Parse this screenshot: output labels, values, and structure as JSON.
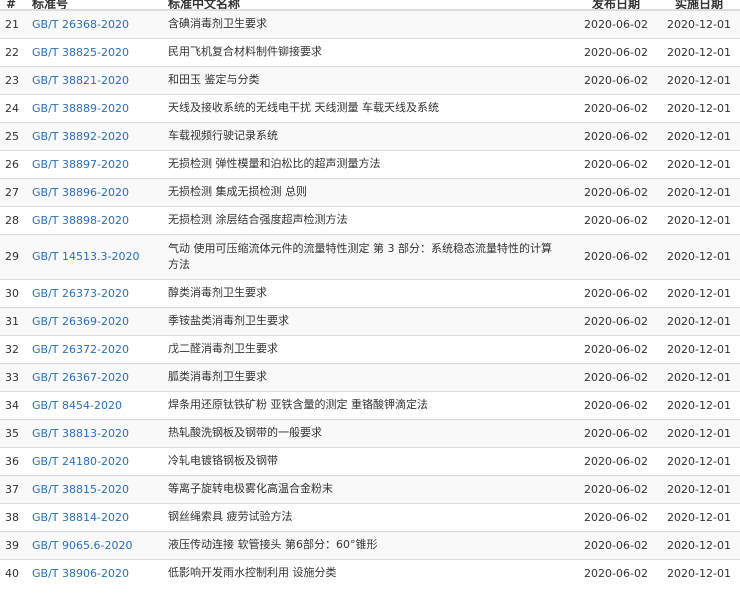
{
  "headers": {
    "num": "#",
    "code": "标准号",
    "title": "标准中文名称",
    "publish": "发布日期",
    "effective": "实施日期"
  },
  "rows": [
    {
      "num": "21",
      "code": "GB/T 26368-2020",
      "title": "含碘消毒剂卫生要求",
      "publish": "2020-06-02",
      "effective": "2020-12-01"
    },
    {
      "num": "22",
      "code": "GB/T 38825-2020",
      "title": "民用飞机复合材料制件铆接要求",
      "publish": "2020-06-02",
      "effective": "2020-12-01"
    },
    {
      "num": "23",
      "code": "GB/T 38821-2020",
      "title": "和田玉 鉴定与分类",
      "publish": "2020-06-02",
      "effective": "2020-12-01"
    },
    {
      "num": "24",
      "code": "GB/T 38889-2020",
      "title": "天线及接收系统的无线电干扰 天线测量 车载天线及系统",
      "publish": "2020-06-02",
      "effective": "2020-12-01"
    },
    {
      "num": "25",
      "code": "GB/T 38892-2020",
      "title": "车载视频行驶记录系统",
      "publish": "2020-06-02",
      "effective": "2020-12-01"
    },
    {
      "num": "26",
      "code": "GB/T 38897-2020",
      "title": "无损检测 弹性模量和泊松比的超声测量方法",
      "publish": "2020-06-02",
      "effective": "2020-12-01"
    },
    {
      "num": "27",
      "code": "GB/T 38896-2020",
      "title": "无损检测 集成无损检测 总则",
      "publish": "2020-06-02",
      "effective": "2020-12-01"
    },
    {
      "num": "28",
      "code": "GB/T 38898-2020",
      "title": "无损检测 涂层结合强度超声检测方法",
      "publish": "2020-06-02",
      "effective": "2020-12-01"
    },
    {
      "num": "29",
      "code": "GB/T 14513.3-2020",
      "title": "气动 使用可压缩流体元件的流量特性测定 第 3 部分：系统稳态流量特性的计算方法",
      "title_line1": "气动 使用可压缩流体元件的流量特性测定 第 3 部分：系统稳态流量特性的计算",
      "title_line2": "方法",
      "publish": "2020-06-02",
      "effective": "2020-12-01"
    },
    {
      "num": "30",
      "code": "GB/T 26373-2020",
      "title": "醇类消毒剂卫生要求",
      "publish": "2020-06-02",
      "effective": "2020-12-01"
    },
    {
      "num": "31",
      "code": "GB/T 26369-2020",
      "title": "季铵盐类消毒剂卫生要求",
      "publish": "2020-06-02",
      "effective": "2020-12-01"
    },
    {
      "num": "32",
      "code": "GB/T 26372-2020",
      "title": "戊二醛消毒剂卫生要求",
      "publish": "2020-06-02",
      "effective": "2020-12-01"
    },
    {
      "num": "33",
      "code": "GB/T 26367-2020",
      "title": "胍类消毒剂卫生要求",
      "publish": "2020-06-02",
      "effective": "2020-12-01"
    },
    {
      "num": "34",
      "code": "GB/T 8454-2020",
      "title": "焊条用还原钛铁矿粉 亚铁含量的测定 重铬酸钾滴定法",
      "publish": "2020-06-02",
      "effective": "2020-12-01"
    },
    {
      "num": "35",
      "code": "GB/T 38813-2020",
      "title": "热轧酸洗钢板及钢带的一般要求",
      "publish": "2020-06-02",
      "effective": "2020-12-01"
    },
    {
      "num": "36",
      "code": "GB/T 24180-2020",
      "title": "冷轧电镀铬钢板及钢带",
      "publish": "2020-06-02",
      "effective": "2020-12-01"
    },
    {
      "num": "37",
      "code": "GB/T 38815-2020",
      "title": "等离子旋转电极雾化高温合金粉末",
      "publish": "2020-06-02",
      "effective": "2020-12-01"
    },
    {
      "num": "38",
      "code": "GB/T 38814-2020",
      "title": "钢丝绳索具 疲劳试验方法",
      "publish": "2020-06-02",
      "effective": "2020-12-01"
    },
    {
      "num": "39",
      "code": "GB/T 9065.6-2020",
      "title": "液压传动连接 软管接头 第6部分：60°锥形",
      "publish": "2020-06-02",
      "effective": "2020-12-01"
    },
    {
      "num": "40",
      "code": "GB/T 38906-2020",
      "title": "低影响开发雨水控制利用 设施分类",
      "publish": "2020-06-02",
      "effective": "2020-12-01"
    }
  ],
  "colors": {
    "link": "#2a6fb8",
    "text": "#333333",
    "border": "#dddddd",
    "stripe": "#f9f9f9"
  }
}
